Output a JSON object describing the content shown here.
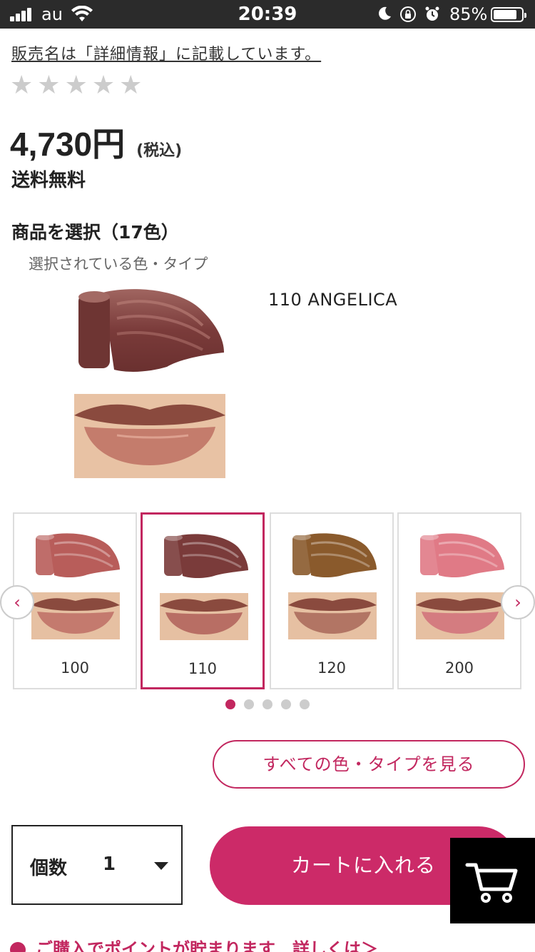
{
  "status_bar": {
    "carrier": "au",
    "time": "20:39",
    "battery_pct": "85%",
    "battery_level": 0.85,
    "icons": [
      "signal-icon",
      "wifi-icon",
      "moon-icon",
      "rotation-lock-icon",
      "alarm-icon",
      "battery-icon"
    ]
  },
  "product": {
    "note_link": "販売名は「詳細情報」に記載しています。",
    "rating_stars": 0,
    "rating_max": 5,
    "price": "4,730円",
    "tax_note": "(税込)",
    "shipping": "送料無料",
    "select_title": "商品を選択（17色）",
    "selected_caption": "選択されている色・タイプ",
    "selected_name": "110  ANGELICA"
  },
  "carousel": {
    "items": [
      {
        "number": "100",
        "swatch_color": "#b85d5a",
        "lip_color": "#c47a6e"
      },
      {
        "number": "110",
        "swatch_color": "#7a3b3a",
        "lip_color": "#b86e64"
      },
      {
        "number": "120",
        "swatch_color": "#8a5a2c",
        "lip_color": "#b27564"
      },
      {
        "number": "200",
        "swatch_color": "#e07a86",
        "lip_color": "#d47c80"
      }
    ],
    "selected_index": 1,
    "page_count": 5,
    "current_page": 0
  },
  "actions": {
    "all_colors_label": "すべての色・タイプを見る",
    "qty_label": "個数",
    "qty_value": "1",
    "add_to_cart_label": "カートに入れる",
    "points_text": "ご購入でポイントが貯まります　詳しくは＞"
  },
  "colors": {
    "accent": "#c2275f",
    "cart_button": "#cc2a68",
    "status_bar_bg": "#2b2b2b"
  }
}
